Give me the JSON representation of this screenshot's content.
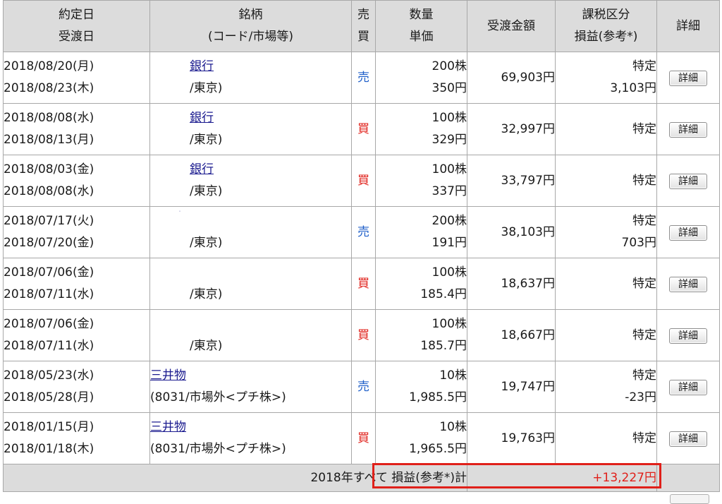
{
  "header": {
    "date_1": "約定日",
    "date_2": "受渡日",
    "name_1": "銘柄",
    "name_2": "(コード/市場等)",
    "side_1": "売",
    "side_2": "買",
    "qty_1": "数量",
    "qty_2": "単価",
    "amount": "受渡金額",
    "tax_1": "課税区分",
    "tax_2": "損益(参考*)",
    "detail": "詳細"
  },
  "rows": [
    {
      "trade_date": "2018/08/20(月)",
      "settle_date": "2018/08/23(木)",
      "stock": "銀行",
      "market": "/東京)",
      "side": "売",
      "side_type": "sell",
      "qty": "200株",
      "price": "350円",
      "amount": "69,903円",
      "tax": "特定",
      "pl": "3,103円",
      "detail": "詳細"
    },
    {
      "trade_date": "2018/08/08(水)",
      "settle_date": "2018/08/13(月)",
      "stock": "銀行",
      "market": "/東京)",
      "side": "買",
      "side_type": "buy",
      "qty": "100株",
      "price": "329円",
      "amount": "32,997円",
      "tax": "特定",
      "pl": "",
      "detail": "詳細"
    },
    {
      "trade_date": "2018/08/03(金)",
      "settle_date": "2018/08/08(水)",
      "stock": "銀行",
      "market": "/東京)",
      "side": "買",
      "side_type": "buy",
      "qty": "100株",
      "price": "337円",
      "amount": "33,797円",
      "tax": "特定",
      "pl": "",
      "detail": "詳細"
    },
    {
      "trade_date": "2018/07/17(火)",
      "settle_date": "2018/07/20(金)",
      "stock": "",
      "market": "/東京)",
      "side": "売",
      "side_type": "sell",
      "qty": "200株",
      "price": "191円",
      "amount": "38,103円",
      "tax": "特定",
      "pl": "703円",
      "detail": "詳細"
    },
    {
      "trade_date": "2018/07/06(金)",
      "settle_date": "2018/07/11(水)",
      "stock": "",
      "market": "/東京)",
      "side": "買",
      "side_type": "buy",
      "qty": "100株",
      "price": "185.4円",
      "amount": "18,637円",
      "tax": "特定",
      "pl": "",
      "detail": "詳細"
    },
    {
      "trade_date": "2018/07/06(金)",
      "settle_date": "2018/07/11(水)",
      "stock": "",
      "market": "/東京)",
      "side": "買",
      "side_type": "buy",
      "qty": "100株",
      "price": "185.7円",
      "amount": "18,667円",
      "tax": "特定",
      "pl": "",
      "detail": "詳細"
    },
    {
      "trade_date": "2018/05/23(水)",
      "settle_date": "2018/05/28(月)",
      "stock": "三井物",
      "market": "(8031/市場外<プチ株>)",
      "side": "売",
      "side_type": "sell",
      "qty": "10株",
      "price": "1,985.5円",
      "amount": "19,747円",
      "tax": "特定",
      "pl": "-23円",
      "detail": "詳細"
    },
    {
      "trade_date": "2018/01/15(月)",
      "settle_date": "2018/01/18(木)",
      "stock": "三井物",
      "market": "(8031/市場外<プチ株>)",
      "side": "買",
      "side_type": "buy",
      "qty": "10株",
      "price": "1,965.5円",
      "amount": "19,763円",
      "tax": "特定",
      "pl": "",
      "detail": "詳細"
    }
  ],
  "total": {
    "label": "2018年すべて 損益(参考*)計",
    "value": "+13,227円"
  },
  "colors": {
    "sell": "#1f5fc9",
    "buy": "#e0201a",
    "header_bg": "#dcdcdc",
    "highlight_border": "#e0201a"
  }
}
